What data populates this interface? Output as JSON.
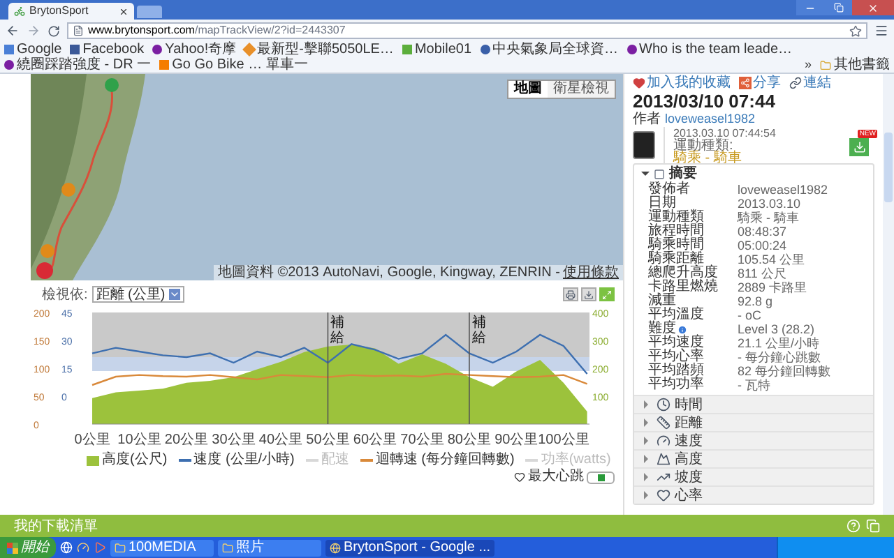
{
  "browser": {
    "tab_title": "BrytonSport",
    "url_host": "www.brytonsport.com",
    "url_path": "/mapTrackView/2?id=2443307",
    "bookmarks": [
      {
        "label": "Google",
        "kind": "google"
      },
      {
        "label": "Facebook",
        "kind": "facebook"
      },
      {
        "label": "Yahoo!奇摩",
        "kind": "yahoo"
      },
      {
        "label": "最新型-擊聯5050LE…",
        "kind": "diamond"
      },
      {
        "label": "Mobile01",
        "kind": "mobile01"
      },
      {
        "label": "中央氣象局全球資…",
        "kind": "eye"
      },
      {
        "label": "Who is the team leade…",
        "kind": "yahoo"
      },
      {
        "label": "繞圈踩踏強度 - DR 一",
        "kind": "yahoo"
      },
      {
        "label": "Go Go Bike … 單車一",
        "kind": "blogger"
      }
    ],
    "more": "»",
    "other_bookmarks": "其他書籤"
  },
  "map": {
    "buttons": [
      {
        "label": "地圖",
        "selected": true
      },
      {
        "label": "衛星檢視",
        "selected": false
      }
    ],
    "attribution": "地圖資料 ©2013 AutoNavi, Google, Kingway, ZENRIN -",
    "terms_link": "使用條款"
  },
  "chart": {
    "view_label": "檢視依:",
    "view_select": "距離 (公里)",
    "chart_data": {
      "type": "line",
      "xlim": [
        0,
        105.5
      ],
      "x": [
        0,
        5,
        10,
        15,
        20,
        25,
        30,
        35,
        40,
        45,
        50,
        55,
        60,
        65,
        70,
        75,
        80,
        85,
        90,
        95,
        100,
        105
      ],
      "xticks": [
        {
          "value": 0,
          "label": "0公里"
        },
        {
          "value": 10,
          "label": "10公里"
        },
        {
          "value": 20,
          "label": "20公里"
        },
        {
          "value": 30,
          "label": "30公里"
        },
        {
          "value": 40,
          "label": "40公里"
        },
        {
          "value": 50,
          "label": "50公里"
        },
        {
          "value": 60,
          "label": "60公里"
        },
        {
          "value": 70,
          "label": "70公里"
        },
        {
          "value": 80,
          "label": "80公里"
        },
        {
          "value": 90,
          "label": "90公里"
        },
        {
          "value": 100,
          "label": "100公里"
        }
      ],
      "ylim": [
        0,
        400
      ],
      "yticks": [
        400,
        300,
        200,
        100
      ],
      "y2lim": [
        0,
        200
      ],
      "y2ticks": [
        200,
        150,
        100,
        50,
        0
      ],
      "y3lim": [
        -15,
        45
      ],
      "y3ticks": [
        45,
        30,
        15,
        0
      ],
      "series": [
        {
          "name": "高度(公尺)",
          "type": "area",
          "color": "#9cc23c",
          "values": [
            93,
            114,
            120,
            127,
            148,
            155,
            168,
            196,
            223,
            258,
            278,
            285,
            271,
            216,
            250,
            216,
            168,
            134,
            189,
            230,
            148,
            45
          ]
        },
        {
          "name": "速度 (公里/小時)",
          "axis": "y3",
          "color": "#3d6fb0",
          "values": [
            23,
            26,
            24,
            22,
            21,
            23,
            18,
            24,
            21,
            26,
            18,
            28,
            25,
            20,
            23,
            33,
            23,
            18,
            24,
            33,
            27,
            12
          ]
        },
        {
          "name": "配速",
          "color": "#d8d8d8",
          "values": [
            null,
            null,
            null,
            null,
            null,
            null,
            null,
            null,
            null,
            null,
            null,
            null,
            null,
            null,
            null,
            null,
            null,
            null,
            null,
            null,
            null,
            null
          ]
        },
        {
          "name": "迴轉速 (每分鐘回轉數)",
          "axis": "y2",
          "color": "#d9893a",
          "values": [
            70,
            85,
            88,
            86,
            85,
            88,
            84,
            80,
            88,
            86,
            84,
            88,
            86,
            87,
            85,
            90,
            88,
            86,
            84,
            85,
            88,
            72
          ]
        },
        {
          "name": "功率(watts)",
          "color": "#d8d8d8",
          "values": [
            null,
            null,
            null,
            null,
            null,
            null,
            null,
            null,
            null,
            null,
            null,
            null,
            null,
            null,
            null,
            null,
            null,
            null,
            null,
            null,
            null,
            null
          ]
        }
      ],
      "bands": [
        {
          "axis": "y2",
          "from": 120,
          "to": 200,
          "color": "#c9c9c9"
        },
        {
          "axis": "y2",
          "from": 95,
          "to": 120,
          "color": "#c6d4ea"
        }
      ],
      "annotations": [
        "補給",
        "補給"
      ]
    },
    "max_heart_label": "最大心跳"
  },
  "detail": {
    "actions": [
      {
        "label": "加入我的收藏",
        "kind": "heart"
      },
      {
        "label": "分享",
        "kind": "share"
      },
      {
        "label": "連結",
        "kind": "link"
      }
    ],
    "title": "2013/03/10 07:44",
    "author_label": "作者",
    "author": "loveweasel1982",
    "timestamp": "2013.03.10 07:44:54",
    "sport_label": "運動種類:",
    "sport": "騎乘 - 騎車",
    "new_badge": "NEW",
    "summary_title": "摘要",
    "summary_expanded": true,
    "summary": [
      {
        "label": "發佈者",
        "value": "loveweasel1982",
        "info": false
      },
      {
        "label": "日期",
        "value": "2013.03.10",
        "info": false
      },
      {
        "label": "運動種類",
        "value": "騎乘 - 騎車",
        "info": false
      },
      {
        "label": "旅程時間",
        "value": "08:48:37",
        "info": false
      },
      {
        "label": "騎乘時間",
        "value": "05:00:24",
        "info": false
      },
      {
        "label": "騎乘距離",
        "value": "105.54 公里",
        "info": false
      },
      {
        "label": "總爬升高度",
        "value": "811 公尺",
        "info": false
      },
      {
        "label": "卡路里燃燒",
        "value": "2889 卡路里",
        "info": false
      },
      {
        "label": "減重",
        "value": "92.8 g",
        "info": false
      },
      {
        "label": "平均溫度",
        "value": "- oC",
        "info": false
      },
      {
        "label": "難度",
        "value": "Level 3 (28.2)",
        "info": true
      },
      {
        "label": "平均速度",
        "value": "21.1 公里/小時",
        "info": false
      },
      {
        "label": "平均心率",
        "value": "- 每分鐘心跳數",
        "info": false
      },
      {
        "label": "平均踏頻",
        "value": "82 每分鐘回轉數",
        "info": false
      },
      {
        "label": "平均功率",
        "value": "- 瓦特",
        "info": false
      }
    ],
    "sections": [
      {
        "label": "時間",
        "kind": "clock",
        "expanded": false
      },
      {
        "label": "距離",
        "kind": "distance",
        "expanded": false
      },
      {
        "label": "速度",
        "kind": "speed",
        "expanded": false
      },
      {
        "label": "高度",
        "kind": "mountain",
        "expanded": false
      },
      {
        "label": "坡度",
        "kind": "slope",
        "expanded": false
      },
      {
        "label": "心率",
        "kind": "heart",
        "expanded": false
      }
    ]
  },
  "download_bar": {
    "title": "我的下載清單"
  },
  "taskbar": {
    "start": "開始",
    "windows": [
      {
        "label": "100MEDIA",
        "kind": "folder",
        "selected": false
      },
      {
        "label": "照片",
        "kind": "folder",
        "selected": false
      },
      {
        "label": "BrytonSport - Google ...",
        "kind": "browser",
        "selected": true
      }
    ]
  }
}
